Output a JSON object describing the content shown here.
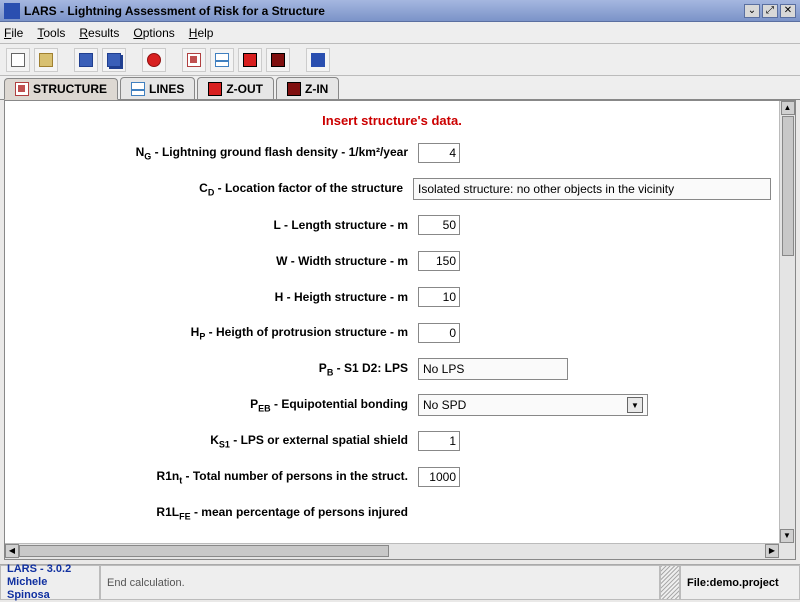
{
  "window": {
    "title": "LARS - Lightning Assessment of Risk for a Structure"
  },
  "menu": {
    "file": "File",
    "tools": "Tools",
    "results": "Results",
    "options": "Options",
    "help": "Help"
  },
  "tabs": {
    "structure": "STRUCTURE",
    "lines": "LINES",
    "zout": "Z-OUT",
    "zin": "Z-IN"
  },
  "form": {
    "heading": "Insert structure's data.",
    "ng_label": "N",
    "ng_sub": "G",
    "ng_rest": " - Lightning ground flash density - 1/km²/year",
    "ng_value": "4",
    "cd_label": "C",
    "cd_sub": "D",
    "cd_rest": " - Location factor of the structure",
    "cd_value": "Isolated structure: no other objects in the vicinity",
    "l_label": "L - Length structure - m",
    "l_value": "50",
    "w_label": "W - Width structure - m",
    "w_value": "150",
    "h_label": "H - Heigth structure - m",
    "h_value": "10",
    "hp_label": "H",
    "hp_sub": "P",
    "hp_rest": " - Heigth of protrusion structure - m",
    "hp_value": "0",
    "pb_label": "P",
    "pb_sub": "B",
    "pb_rest": " - S1 D2: LPS",
    "pb_value": "No LPS",
    "peb_label": "P",
    "peb_sub": "EB",
    "peb_rest": " - Equipotential bonding",
    "peb_value": "No SPD",
    "ks1_label": "K",
    "ks1_sub": "S1",
    "ks1_rest": " - LPS or external spatial shield",
    "ks1_value": "1",
    "r1nt_label": "R1n",
    "r1nt_sub": "t",
    "r1nt_rest": " - Total number of persons in the struct.",
    "r1nt_value": "1000",
    "r1lfe_label": "R1L",
    "r1lfe_sub": "FE",
    "r1lfe_rest": " - mean percentage of persons injured"
  },
  "status": {
    "version": "LARS - 3.0.2",
    "author": "Michele Spinosa",
    "message": "End calculation.",
    "file_label": "File: ",
    "file_name": "demo.project"
  }
}
